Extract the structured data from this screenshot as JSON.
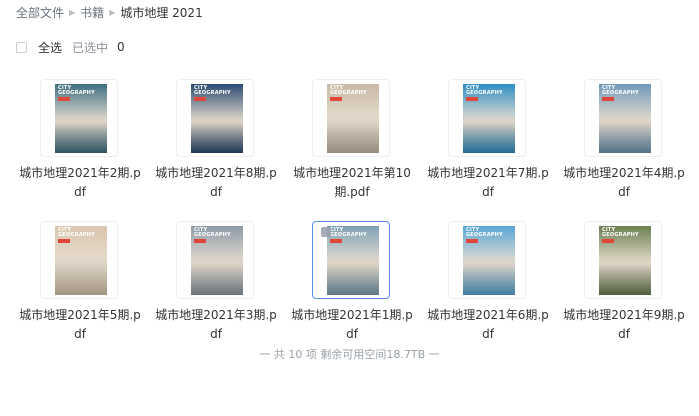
{
  "breadcrumb": {
    "items": [
      "全部文件",
      "书籍",
      "城市地理 2021"
    ]
  },
  "select_bar": {
    "select_all_label": "全选",
    "selected_label": "已选中",
    "selected_count": "0"
  },
  "files": [
    {
      "name": "城市地理2021年2期.pdf",
      "cover_masthead": "CITY GEOGRAPHY",
      "cover_color": "#3f6f83"
    },
    {
      "name": "城市地理2021年8期.pdf",
      "cover_masthead": "CITY GEOGRAPHY",
      "cover_color": "#2a4a72"
    },
    {
      "name": "城市地理2021年第10期.pdf",
      "cover_masthead": "CITY GEOGRAPHY",
      "cover_color": "#c9b9a6"
    },
    {
      "name": "城市地理2021年7期.pdf",
      "cover_masthead": "CITY GEOGRAPHY",
      "cover_color": "#2f8fc5"
    },
    {
      "name": "城市地理2021年4期.pdf",
      "cover_masthead": "CITY GEOGRAPHY",
      "cover_color": "#6f98b8"
    },
    {
      "name": "城市地理2021年5期.pdf",
      "cover_masthead": "CITY GEOGRAPHY",
      "cover_color": "#d9c6ad"
    },
    {
      "name": "城市地理2021年3期.pdf",
      "cover_masthead": "CITY GEOGRAPHY",
      "cover_color": "#8d9aa8"
    },
    {
      "name": "城市地理2021年1期.pdf",
      "cover_masthead": "CITY GEOGRAPHY",
      "cover_color": "#7fa1b5",
      "active": true
    },
    {
      "name": "城市地理2021年6期.pdf",
      "cover_masthead": "CITY GEOGRAPHY",
      "cover_color": "#59a7d7"
    },
    {
      "name": "城市地理2021年9期.pdf",
      "cover_masthead": "CITY GEOGRAPHY",
      "cover_color": "#6c7f52"
    }
  ],
  "footer": {
    "summary": "一 共 10 项 剩余可用空间18.7TB 一"
  }
}
